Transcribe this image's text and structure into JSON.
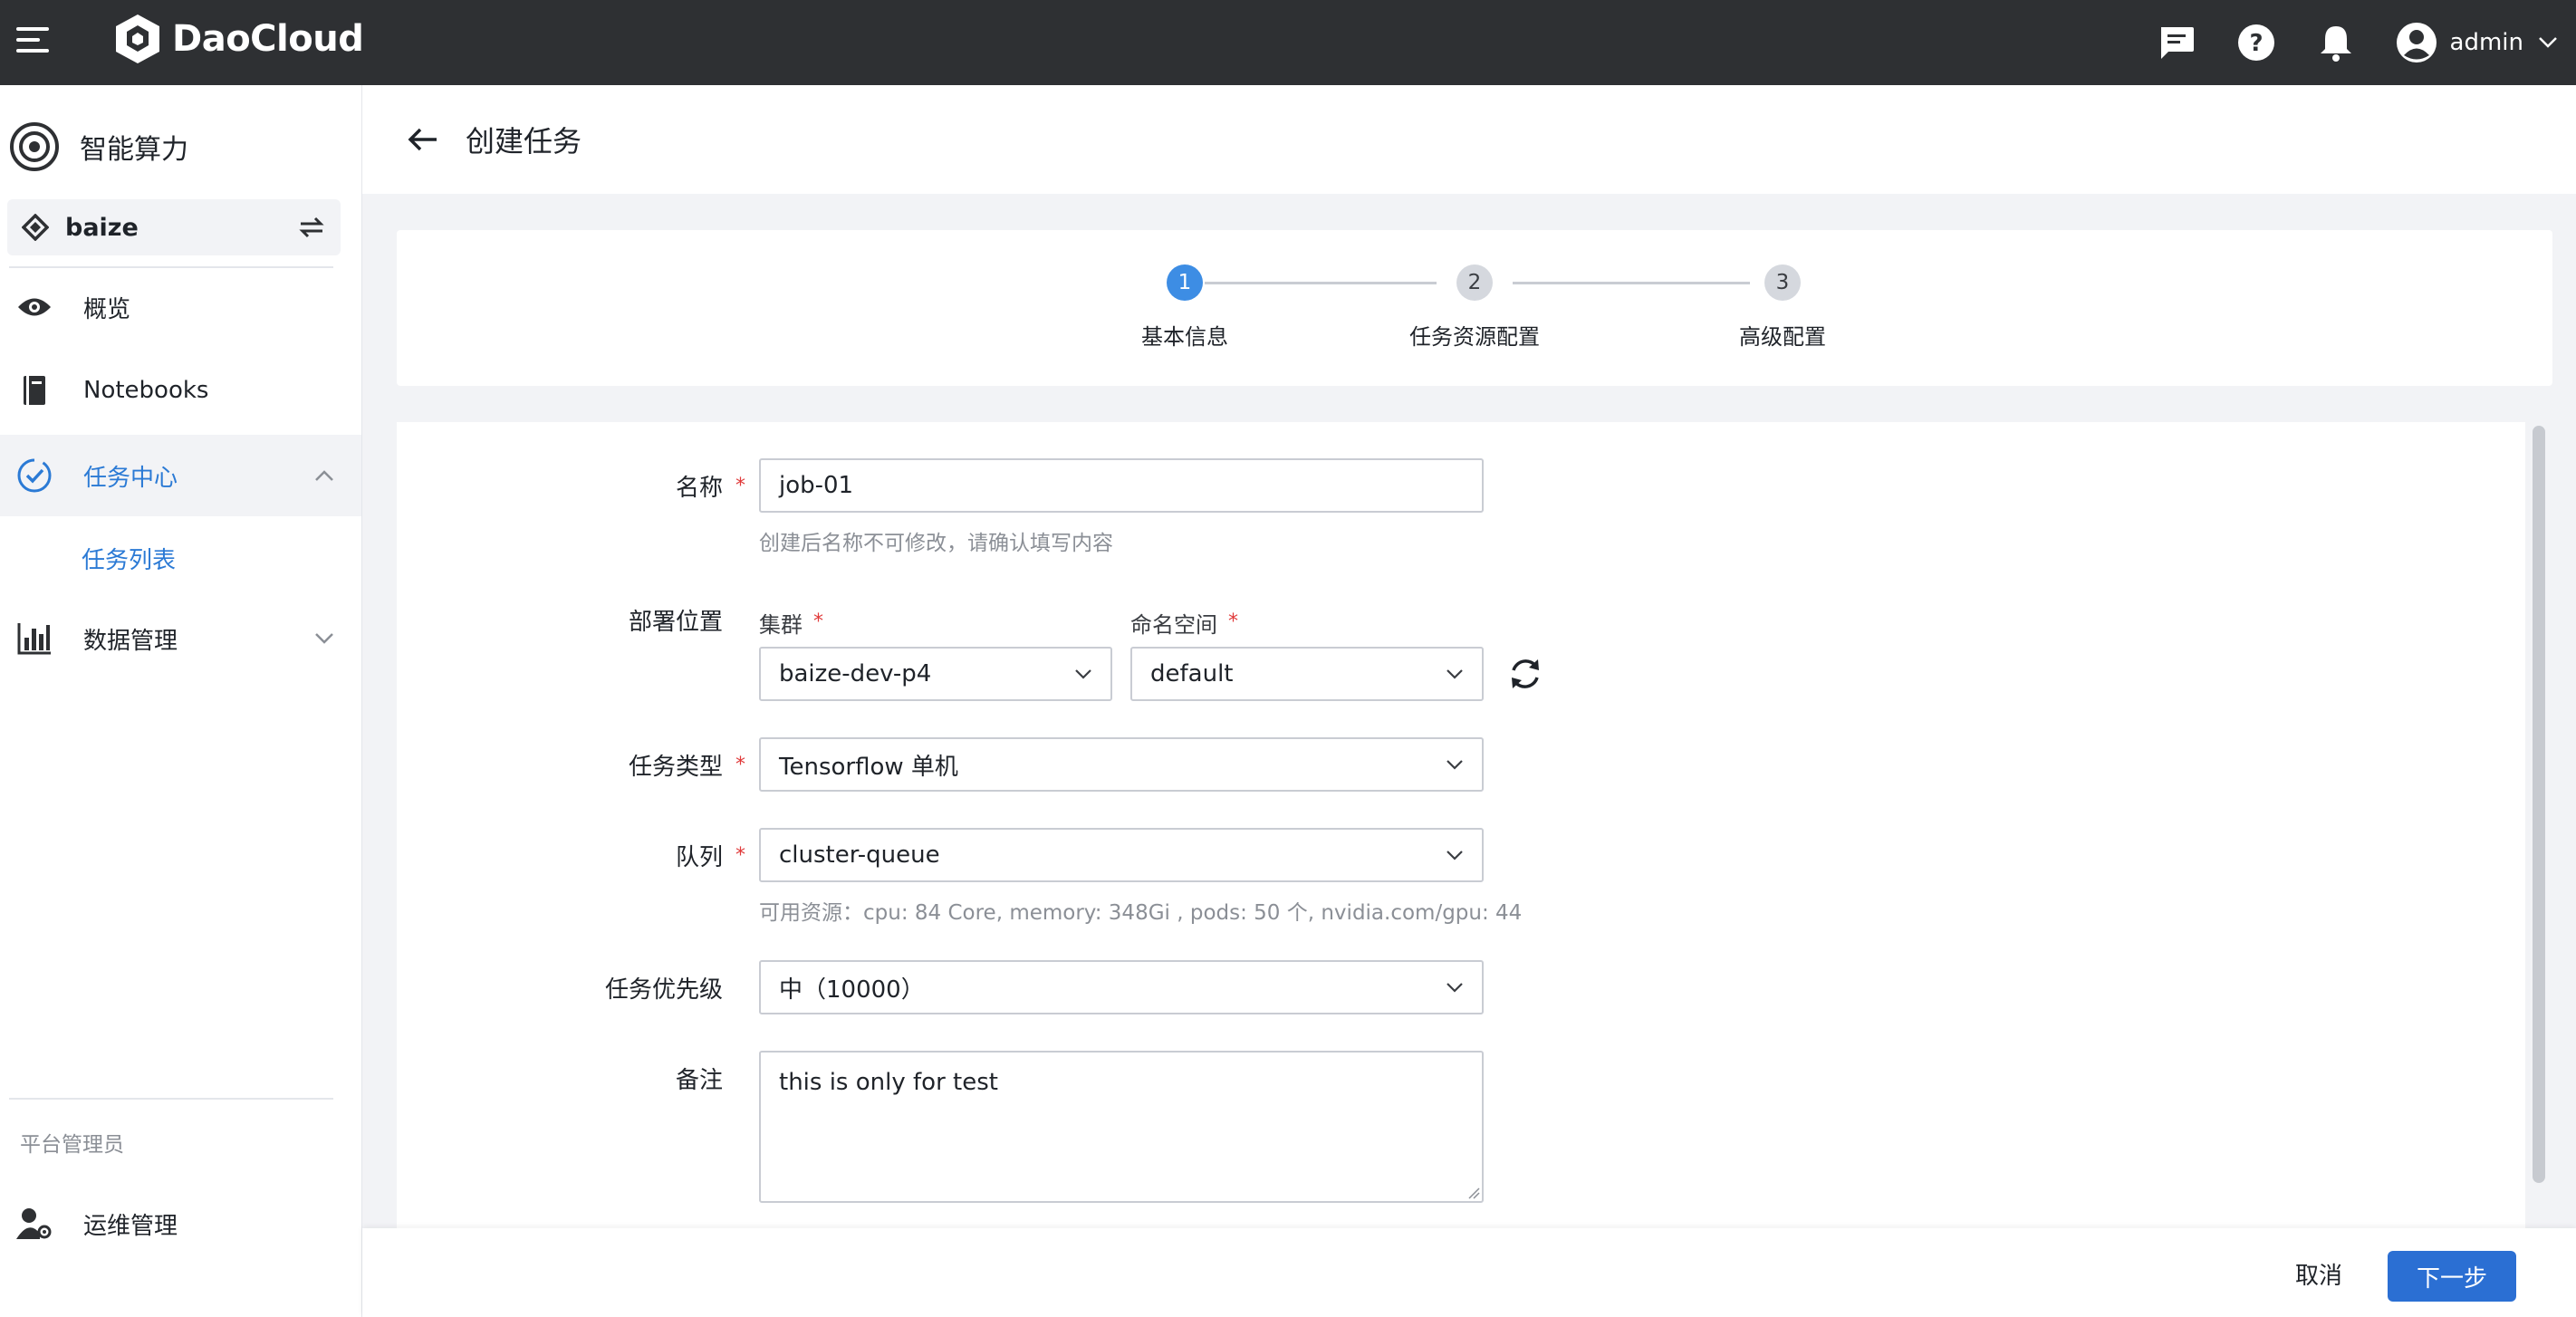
{
  "topbar": {
    "brand": "DaoCloud",
    "user": "admin"
  },
  "sidebar": {
    "app_title": "智能算力",
    "workspace": "baize",
    "items": [
      {
        "label": "概览"
      },
      {
        "label": "Notebooks"
      },
      {
        "label": "任务中心"
      },
      {
        "label": "任务列表"
      },
      {
        "label": "数据管理"
      }
    ],
    "section_admin": "平台管理员",
    "admin_item": "运维管理"
  },
  "page": {
    "title": "创建任务"
  },
  "steps": [
    {
      "num": "1",
      "label": "基本信息",
      "active": true
    },
    {
      "num": "2",
      "label": "任务资源配置",
      "active": false
    },
    {
      "num": "3",
      "label": "高级配置",
      "active": false
    }
  ],
  "form": {
    "name_label": "名称",
    "name_value": "job-01",
    "name_hint": "创建后名称不可修改，请确认填写内容",
    "deploy_label": "部署位置",
    "cluster_label": "集群",
    "cluster_value": "baize-dev-p4",
    "namespace_label": "命名空间",
    "namespace_value": "default",
    "type_label": "任务类型",
    "type_value": "Tensorflow 单机",
    "queue_label": "队列",
    "queue_value": "cluster-queue",
    "queue_hint": "可用资源：cpu: 84 Core, memory: 348Gi , pods: 50 个, nvidia.com/gpu: 44",
    "priority_label": "任务优先级",
    "priority_value": "中（10000）",
    "remark_label": "备注",
    "remark_value": "this is only for test"
  },
  "footer": {
    "cancel": "取消",
    "next": "下一步"
  },
  "colors": {
    "topbar": "#2e3033",
    "accent": "#2b7ad5",
    "primary_button": "#2b6fd3",
    "required": "#e03a3a"
  }
}
